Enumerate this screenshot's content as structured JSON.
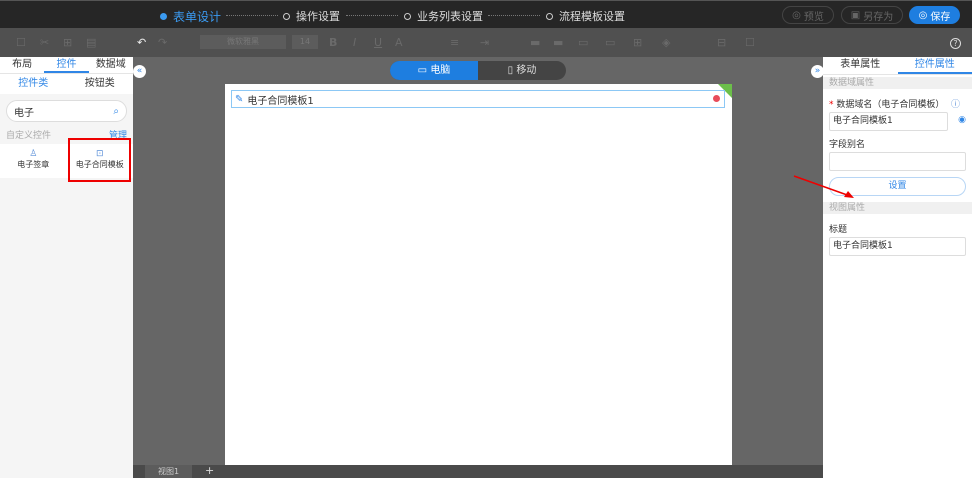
{
  "steps": [
    "表单设计",
    "操作设置",
    "业务列表设置",
    "流程模板设置"
  ],
  "header_buttons": {
    "preview": "预览",
    "save_as": "另存为",
    "save": "保存"
  },
  "toolbar": {
    "font": "微软雅黑",
    "size": "14",
    "bold": "B",
    "italic": "I",
    "underline": "U",
    "color": "A",
    "help": "?"
  },
  "left": {
    "tabs": [
      "布局",
      "控件",
      "数据域"
    ],
    "subtabs": [
      "控件类",
      "按钮类"
    ],
    "search_value": "电子",
    "section": "自定义控件",
    "manage": "管理",
    "items": [
      "电子签章",
      "电子合同模板"
    ]
  },
  "view_toggle": [
    "电脑",
    "移动"
  ],
  "canvas": {
    "control_label": "电子合同模板1"
  },
  "bottom": {
    "view_tab": "视图1",
    "add": "+"
  },
  "right": {
    "tabs": [
      "表单属性",
      "控件属性"
    ],
    "data_section": "数据域属性",
    "field_label": "数据域名（电子合同模板）",
    "field_value": "电子合同模板1",
    "alias_label": "字段别名",
    "alias_value": "",
    "settings_button": "设置",
    "view_section": "视图属性",
    "title_label": "标题",
    "title_value": "电子合同模板1"
  },
  "colors": {
    "accent": "#1e7ee0",
    "highlight": "#e00000"
  }
}
